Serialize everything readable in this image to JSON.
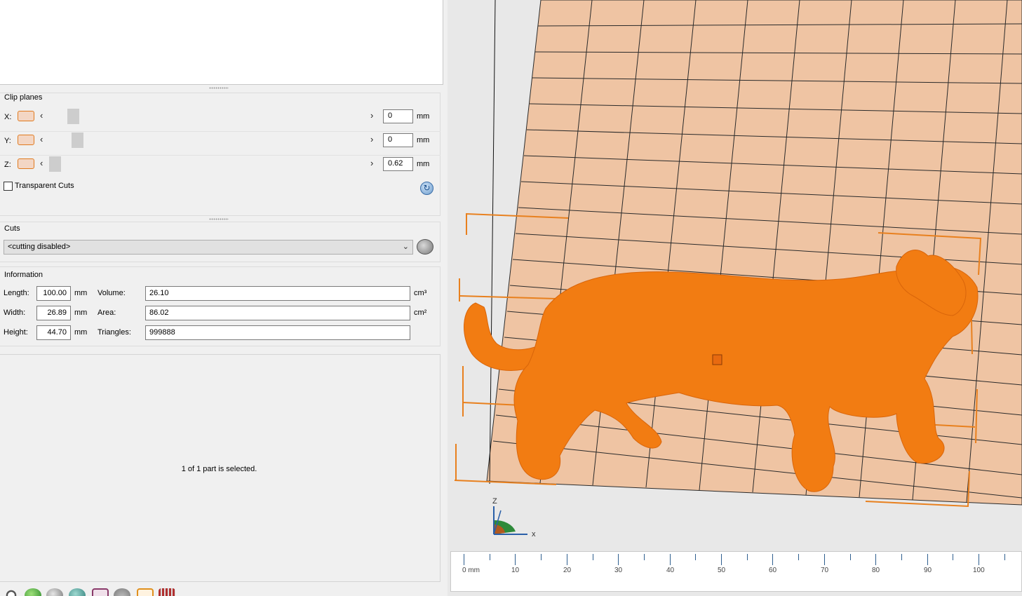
{
  "clip_planes": {
    "title": "Clip planes",
    "unit": "mm",
    "rows": [
      {
        "axis": "X:",
        "value": "0"
      },
      {
        "axis": "Y:",
        "value": "0"
      },
      {
        "axis": "Z:",
        "value": "0.62"
      }
    ],
    "transparent_cuts_label": "Transparent Cuts",
    "transparent_cuts_checked": false
  },
  "cuts": {
    "title": "Cuts",
    "selected": "<cutting disabled>"
  },
  "information": {
    "title": "Information",
    "length_label": "Length:",
    "length": "100.00",
    "width_label": "Width:",
    "width": "26.89",
    "height_label": "Height:",
    "height": "44.70",
    "mm": "mm",
    "volume_label": "Volume:",
    "volume": "26.10",
    "volume_unit": "cm³",
    "area_label": "Area:",
    "area": "86.02",
    "area_unit": "cm²",
    "triangles_label": "Triangles:",
    "triangles": "999888"
  },
  "status": {
    "text": "1 of 1 part is selected."
  },
  "viewport": {
    "axis_z": "Z",
    "axis_x": "x",
    "ruler_labels": [
      "0 mm",
      "10",
      "20",
      "30",
      "40",
      "50",
      "60",
      "70",
      "80",
      "90",
      "100"
    ],
    "colors": {
      "model": "#f27c12",
      "bed": "#efc4a3",
      "selection": "#e8801e"
    }
  },
  "toolbar": {
    "icons": [
      "settings-icon",
      "globe-icon",
      "spheres-icon",
      "teal-sphere-icon",
      "frame-icon",
      "dome-icon",
      "view-icon",
      "castle-icon"
    ]
  }
}
